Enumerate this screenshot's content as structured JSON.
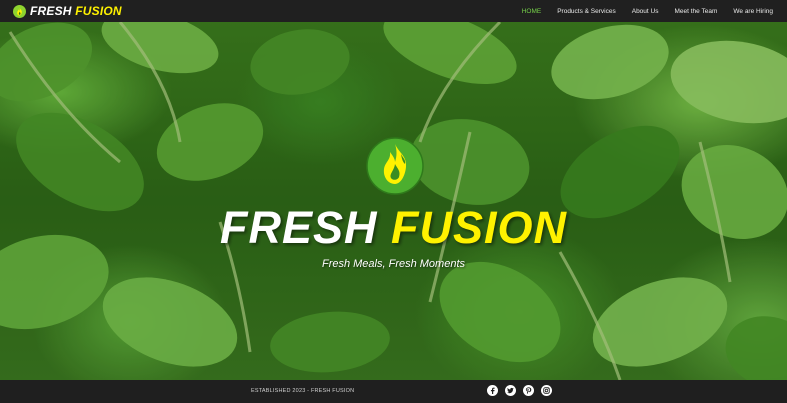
{
  "brand": {
    "part1": "FRESH",
    "part2": "FUSION",
    "accent_color": "#fff200",
    "logo_color": "#8ed42f"
  },
  "nav": {
    "items": [
      {
        "label": "HOME",
        "active": true
      },
      {
        "label": "Products & Services",
        "active": false
      },
      {
        "label": "About Us",
        "active": false
      },
      {
        "label": "Meet the Team",
        "active": false
      },
      {
        "label": "We are Hiring",
        "active": false
      }
    ],
    "active_color": "#76d34a"
  },
  "hero": {
    "title_part1": "FRESH",
    "title_part2": "FUSION",
    "tagline": "Fresh Meals, Fresh Moments",
    "logo_icon": "flame-icon"
  },
  "footer": {
    "text": "ESTABLISHED 2023 - FRESH FUSION",
    "socials": [
      {
        "name": "facebook-icon"
      },
      {
        "name": "twitter-icon"
      },
      {
        "name": "pinterest-icon"
      },
      {
        "name": "instagram-icon"
      }
    ]
  }
}
